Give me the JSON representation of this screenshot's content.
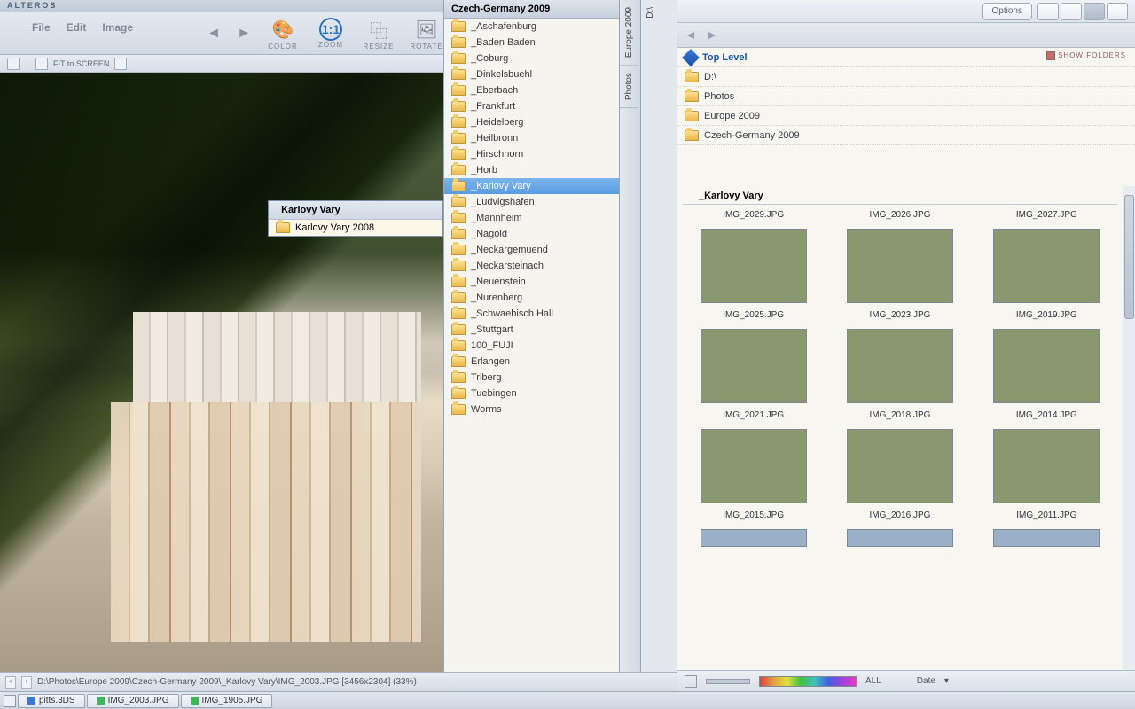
{
  "app_title": "ALTEROS",
  "menu": {
    "file": "File",
    "edit": "Edit",
    "image": "Image"
  },
  "tools": {
    "prev": "PREV",
    "next": "NEXT",
    "color": "COLOR",
    "zoom": "ZOOM",
    "resize": "RESIZE",
    "rotate": "ROTATE"
  },
  "subbar": {
    "fit": "FIT to SCREEN"
  },
  "popout": {
    "header": "_Karlovy Vary",
    "item": "Karlovy Vary 2008"
  },
  "folders": {
    "header": "Czech-Germany 2009",
    "items": [
      "_Aschafenburg",
      "_Baden Baden",
      "_Coburg",
      "_Dinkelsbuehl",
      "_Eberbach",
      "_Frankfurt",
      "_Heidelberg",
      "_Heilbronn",
      "_Hirschhorn",
      "_Horb",
      "_Karlovy Vary",
      "_Ludvigshafen",
      "_Mannheim",
      "_Nagold",
      "_Neckargemuend",
      "_Neckarsteinach",
      "_Neuenstein",
      "_Nurenberg",
      "_Schwaebisch Hall",
      "_Stuttgart",
      "100_FUJI",
      "Erlangen",
      "Triberg",
      "Tuebingen",
      "Worms"
    ],
    "selected_index": 10
  },
  "vtabs": [
    "Europe 2009",
    "Photos",
    "D:\\"
  ],
  "right": {
    "options": "Options",
    "show_folders": "SHOW FOLDERS",
    "crumbs": {
      "top": "Top Level",
      "drive": "D:\\",
      "p1": "Photos",
      "p2": "Europe 2009",
      "p3": "Czech-Germany 2009",
      "current": "_Karlovy Vary"
    },
    "thumbs_row0": [
      "IMG_2029.JPG",
      "IMG_2026.JPG",
      "IMG_2027.JPG"
    ],
    "thumbs": [
      {
        "name": "IMG_2025.JPG",
        "cls": "ph-castle"
      },
      {
        "name": "IMG_2023.JPG",
        "cls": "ph-castle"
      },
      {
        "name": "IMG_2019.JPG",
        "cls": "ph-castle"
      },
      {
        "name": "IMG_2021.JPG",
        "cls": "ph-forest"
      },
      {
        "name": "IMG_2018.JPG",
        "cls": "ph-tower"
      },
      {
        "name": "IMG_2014.JPG",
        "cls": "ph-town"
      },
      {
        "name": "IMG_2015.JPG",
        "cls": "ph-town"
      },
      {
        "name": "IMG_2016.JPG",
        "cls": "ph-town"
      },
      {
        "name": "IMG_2011.JPG",
        "cls": "ph-town"
      }
    ],
    "status": {
      "all": "ALL",
      "date": "Date"
    }
  },
  "lstatus": {
    "path": "D:\\Photos\\Europe 2009\\Czech-Germany 2009\\_Karlovy Vary\\IMG_2003.JPG   [3456x2304]   (33%)"
  },
  "taskbar": {
    "btn1": "pitts.3DS",
    "btn2": "IMG_2003.JPG",
    "btn3": "IMG_1905.JPG"
  }
}
